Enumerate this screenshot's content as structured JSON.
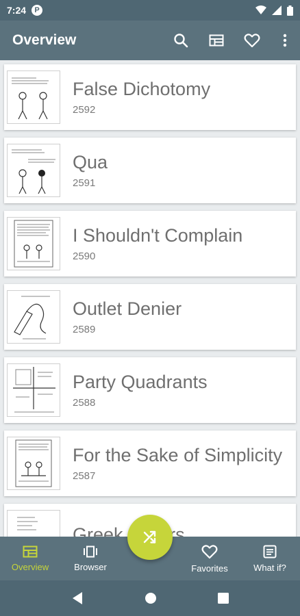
{
  "status_bar": {
    "time": "7:24",
    "notification_letter": "P"
  },
  "app_bar": {
    "title": "Overview",
    "actions": [
      {
        "name": "search-icon"
      },
      {
        "name": "view-toggle-icon"
      },
      {
        "name": "favorite-heart-icon"
      },
      {
        "name": "more-vert-icon"
      }
    ]
  },
  "comics": [
    {
      "title": "False Dichotomy",
      "number": "2592"
    },
    {
      "title": "Qua",
      "number": "2591"
    },
    {
      "title": "I Shouldn't Complain",
      "number": "2590"
    },
    {
      "title": "Outlet Denier",
      "number": "2589"
    },
    {
      "title": "Party Quadrants",
      "number": "2588"
    },
    {
      "title": "For the Sake of Simplicity",
      "number": "2587"
    },
    {
      "title": "Greek Letters",
      "number": ""
    }
  ],
  "bottom_nav": {
    "items": [
      {
        "label": "Overview",
        "icon": "overview-grid-icon",
        "active": true
      },
      {
        "label": "Browser",
        "icon": "browser-carousel-icon",
        "active": false
      },
      {
        "label": "Favorites",
        "icon": "favorites-heart-icon",
        "active": false
      },
      {
        "label": "What if?",
        "icon": "article-icon",
        "active": false
      }
    ],
    "fab_icon": "shuffle-icon"
  },
  "colors": {
    "toolbar": "#5b727d",
    "status_bar": "#4f6773",
    "accent": "#c6d53a",
    "background": "#e9ecee"
  }
}
